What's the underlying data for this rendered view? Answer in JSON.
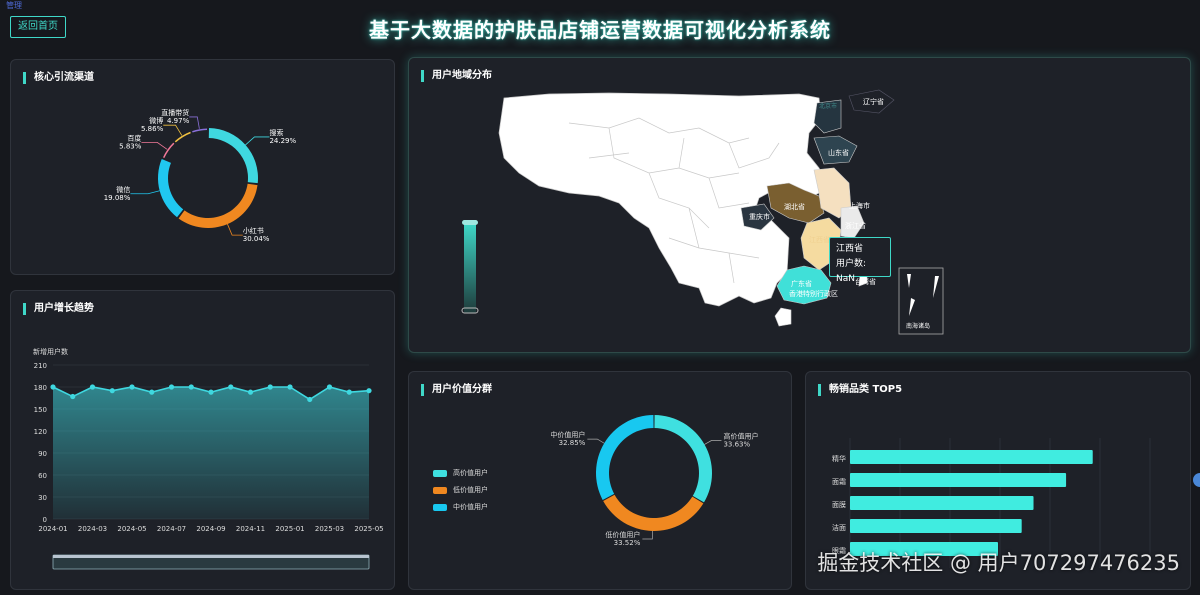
{
  "header": {
    "corner_tag": "管理",
    "back_label": "返回首页",
    "title": "基于大数据的护肤品店铺运营数据可视化分析系统"
  },
  "panels": {
    "channels": "核心引流渠道",
    "growth": "用户增长趋势",
    "map": "用户地域分布",
    "value": "用户价值分群",
    "top5": "畅销品类 TOP5"
  },
  "channels_chart": {
    "type": "pie",
    "slices": [
      {
        "name": "搜索",
        "percent": "24.29%",
        "value": 24.29,
        "color": "#3fd8e0"
      },
      {
        "name": "小红书",
        "percent": "30.04%",
        "value": 30.04,
        "color": "#f08820"
      },
      {
        "name": "微信",
        "percent": "19.08%",
        "value": 19.08,
        "color": "#20c8f0"
      },
      {
        "name": "百度",
        "percent": "5.83%",
        "value": 5.83,
        "color": "#f07898"
      },
      {
        "name": "微博",
        "percent": "5.86%",
        "value": 5.86,
        "color": "#f0c040"
      },
      {
        "name": "直播带货",
        "percent": "4.97%",
        "value": 4.97,
        "color": "#8a70d8"
      }
    ]
  },
  "chart_data": {
    "type": "area",
    "ylabel": "新增用户数",
    "ylim": [
      0,
      210
    ],
    "yticks": [
      0,
      30,
      60,
      90,
      120,
      150,
      180,
      210
    ],
    "xtick_labels": [
      "2024-01",
      "2024-03",
      "2024-05",
      "2024-07",
      "2024-09",
      "2024-11",
      "2025-01",
      "2025-03",
      "2025-05"
    ],
    "x": [
      "2024-01",
      "2024-02",
      "2024-03",
      "2024-04",
      "2024-05",
      "2024-06",
      "2024-07",
      "2024-08",
      "2024-09",
      "2024-10",
      "2024-11",
      "2024-12",
      "2025-01",
      "2025-02",
      "2025-03",
      "2025-04",
      "2025-05"
    ],
    "values": [
      180,
      167,
      180,
      175,
      180,
      173,
      180,
      180,
      173,
      180,
      173,
      180,
      180,
      163,
      180,
      173,
      175
    ],
    "color": "#3fd8e0"
  },
  "map": {
    "labels": {
      "liaoning": "辽宁省",
      "shandong": "山东省",
      "hubei": "湖北省",
      "chongqing": "重庆市",
      "shanghai": "上海市",
      "zhejiang": "浙江省",
      "jiangxi": "江西省",
      "guangdong": "广东省",
      "hongkong": "香港特别行政区",
      "taiwan": "台湾省",
      "nanhai": "南海诸岛",
      "beijing": "北京市"
    },
    "tooltip": {
      "province": "江西省",
      "value_line": "用户数: NaN"
    },
    "colors": {
      "land": "#ffffff",
      "hubei": "#7a5f30",
      "jiangxi": "#f5dba0",
      "anhui": "#f5e0c0",
      "guangdong": "#40e0d8",
      "dark": "#2a3540",
      "shandong": "#2e4450"
    }
  },
  "value_chart": {
    "type": "pie",
    "slices": [
      {
        "name": "高价值用户",
        "percent": "33.63%",
        "value": 33.63,
        "color": "#3fe0e0"
      },
      {
        "name": "低价值用户",
        "percent": "33.52%",
        "value": 33.52,
        "color": "#f08820"
      },
      {
        "name": "中价值用户",
        "percent": "32.85%",
        "value": 32.85,
        "color": "#18c8f0"
      }
    ]
  },
  "top5_chart": {
    "type": "bar",
    "categories": [
      "精华",
      "面霜",
      "面膜",
      "洁面",
      "眼霜"
    ],
    "values": [
      0.82,
      0.73,
      0.62,
      0.58,
      0.5
    ],
    "color": "#40ece0"
  },
  "watermark": "掘金技术社区 @ 用户707297476235"
}
